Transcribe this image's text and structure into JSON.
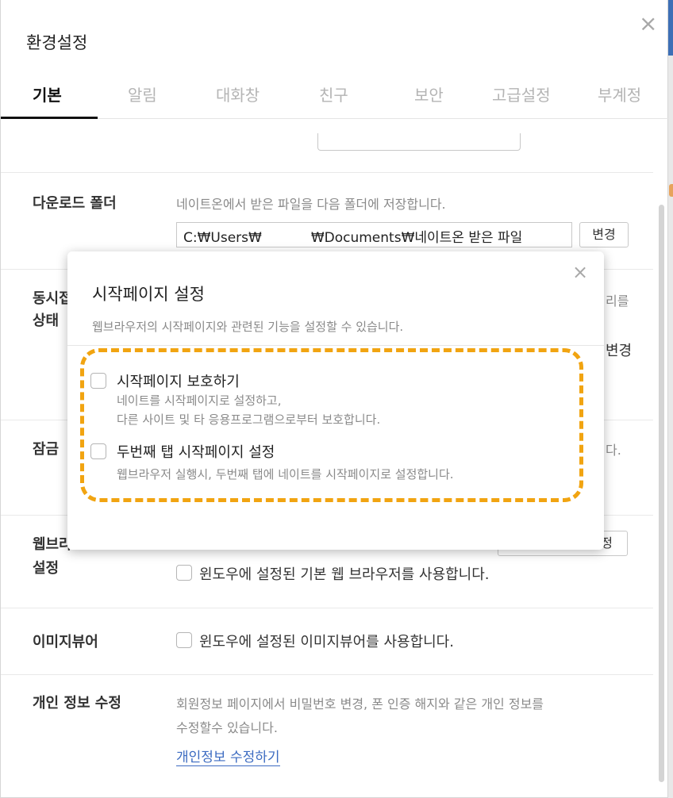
{
  "window": {
    "title": "환경설정",
    "close_glyph": "×"
  },
  "tabs": [
    {
      "label": "기본",
      "active": true
    },
    {
      "label": "알림",
      "active": false
    },
    {
      "label": "대화창",
      "active": false
    },
    {
      "label": "친구",
      "active": false
    },
    {
      "label": "보안",
      "active": false
    },
    {
      "label": "고급설정",
      "active": false
    },
    {
      "label": "부계정",
      "active": false
    }
  ],
  "download": {
    "label": "다운로드 폴더",
    "desc": "네이트온에서 받은 파일을 다음 폴더에 저장합니다.",
    "path_start": "C:₩Users₩",
    "path_end": "₩Documents₩네이트온 받은 파일",
    "change_label": "변경"
  },
  "concurrent": {
    "label_line1": "동시접",
    "label_line2": "상태",
    "desc_tail": "리를",
    "button_tail": "변경"
  },
  "lock": {
    "label": "잠금",
    "desc_tail": "다."
  },
  "browser": {
    "label_line1": "웹브라",
    "label_line2": "설정",
    "button_tail": "설정",
    "checkbox_label": "윈도우에 설정된 기본 웹 브라우저를 사용합니다."
  },
  "image_viewer": {
    "label": "이미지뷰어",
    "checkbox_label": "윈도우에 설정된 이미지뷰어를 사용합니다."
  },
  "privacy": {
    "label": "개인 정보 수정",
    "desc_line1": "회원정보 페이지에서 비밀번호 변경, 폰 인증 해지와 같은 개인 정보를",
    "desc_line2": "수정할수 있습니다.",
    "link": "개인정보 수정하기"
  },
  "modal": {
    "title": "시작페이지 설정",
    "close_glyph": "×",
    "desc": "웹브라우저의 시작페이지와 관련된 기능을 설정할 수 있습니다.",
    "options": [
      {
        "title": "시작페이지 보호하기",
        "desc_line1": "네이트를 시작페이지로 설정하고,",
        "desc_line2": "다른 사이트 및 타 응용프로그램으로부터 보호합니다.",
        "checked": false
      },
      {
        "title": "두번째 탭 시작페이지 설정",
        "desc_line1": "웹브라우저 실행시, 두번째 탭에 네이트를 시작페이지로 설정합니다.",
        "checked": false
      }
    ]
  },
  "colors": {
    "highlight": "#f1a411",
    "link": "#3c6bc1",
    "accent_edge": "#3d6fb6"
  }
}
